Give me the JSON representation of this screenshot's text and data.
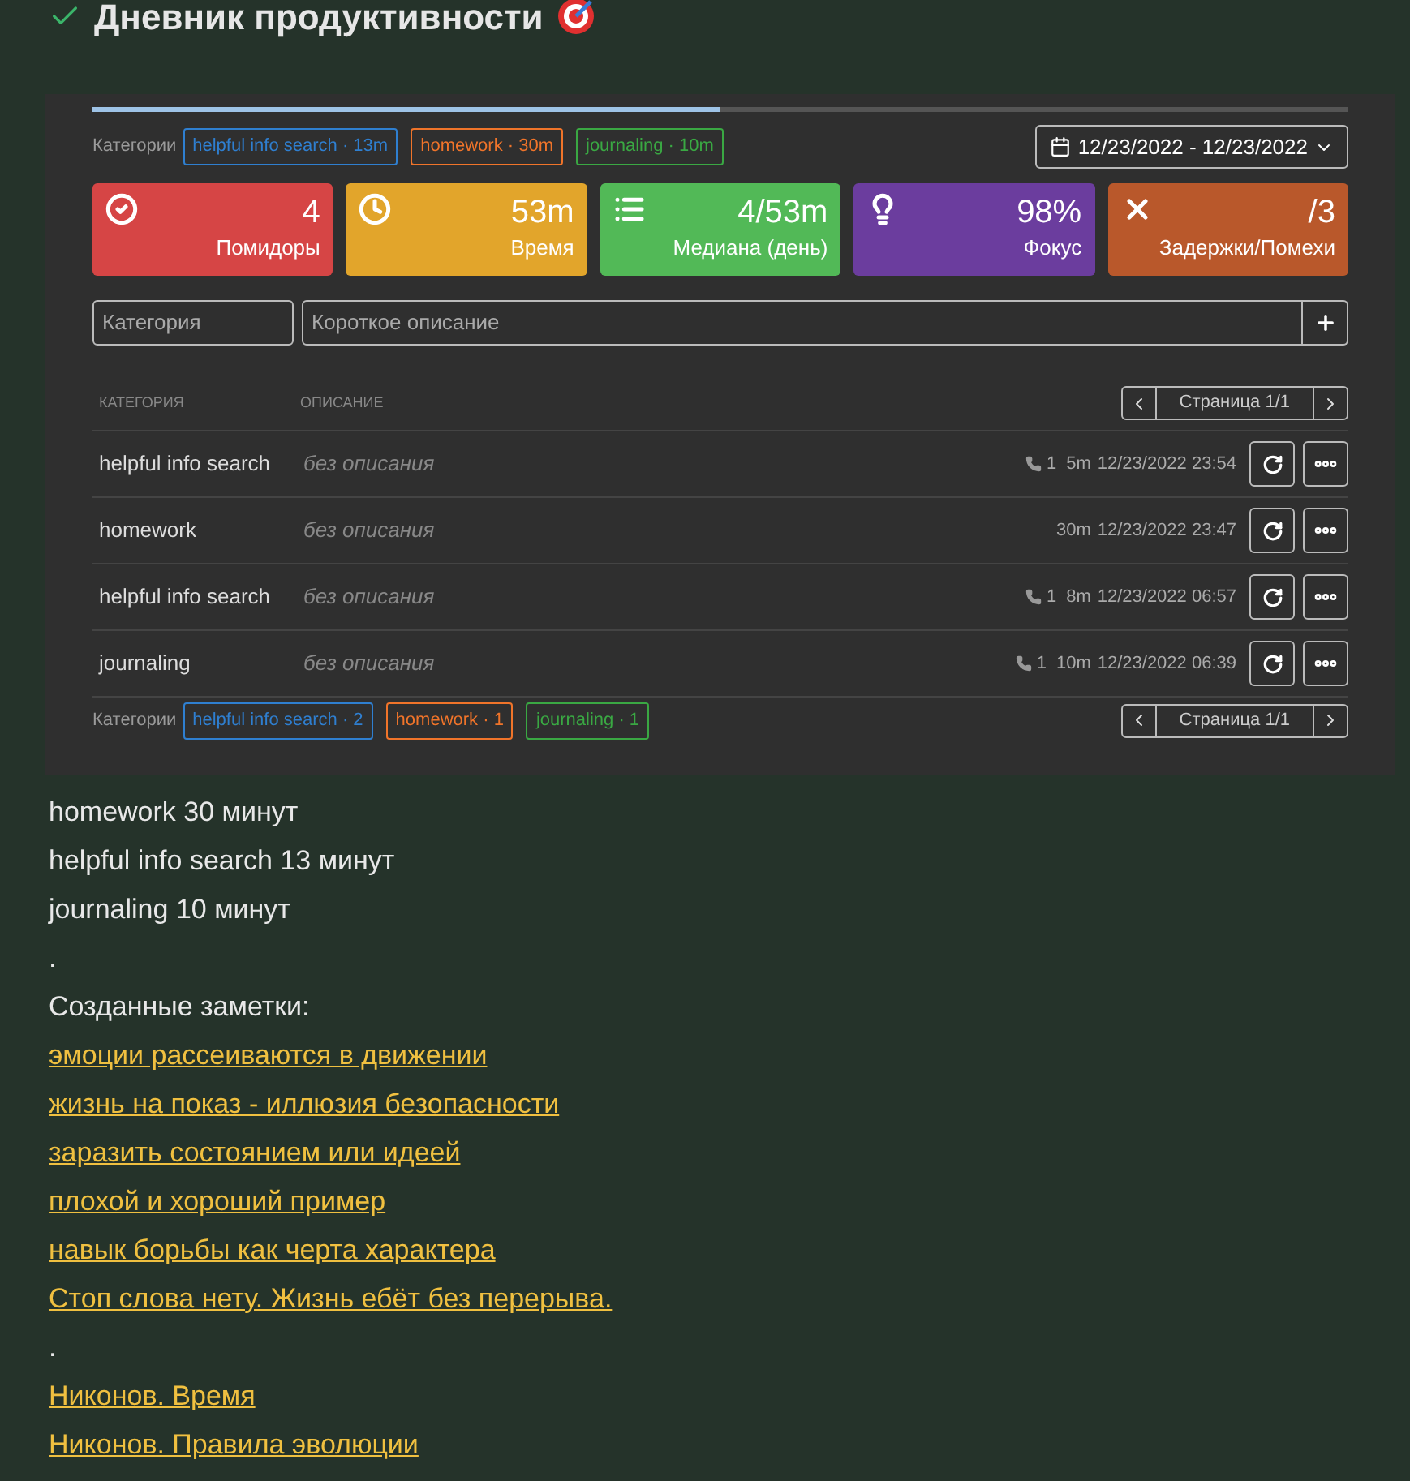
{
  "title": "Дневник продуктивности",
  "tabs": [
    {
      "selected": true
    },
    {
      "selected": false
    }
  ],
  "top_tags_label": "Категории",
  "top_tags": [
    {
      "label": "helpful info search · 13m",
      "color": "#2f7fd0"
    },
    {
      "label": "homework · 30m",
      "color": "#f0742a"
    },
    {
      "label": "journaling · 10m",
      "color": "#3aa843"
    }
  ],
  "date_range": "12/23/2022 - 12/23/2022",
  "stats": [
    {
      "kind": "check",
      "value": "4",
      "label": "Помидоры",
      "color": "#d64545"
    },
    {
      "kind": "clock",
      "value": "53m",
      "label": "Время",
      "color": "#e2a52b"
    },
    {
      "kind": "list",
      "value": "4/53m",
      "label": "Медиана (день)",
      "color": "#52b957"
    },
    {
      "kind": "bulb",
      "value": "98%",
      "label": "Фокус",
      "color": "#6b3d9e"
    },
    {
      "kind": "cross",
      "value": "/3",
      "label": "Задержки/Помехи",
      "color": "#b9582b"
    }
  ],
  "form": {
    "category_placeholder": "Категория",
    "description_placeholder": "Короткое описание"
  },
  "columns": [
    "КАТЕГОРИЯ",
    "ОПИСАНИЕ"
  ],
  "pager": "Страница 1/1",
  "rows": [
    {
      "category": "helpful info search",
      "description": "без описания",
      "calls": "1",
      "duration": "5m",
      "time": "12/23/2022 23:54"
    },
    {
      "category": "homework",
      "description": "без описания",
      "duration": "30m",
      "time": "12/23/2022 23:47"
    },
    {
      "category": "helpful info search",
      "description": "без описания",
      "calls": "1",
      "duration": "8m",
      "time": "12/23/2022 06:57"
    },
    {
      "category": "journaling",
      "description": "без описания",
      "calls": "1",
      "duration": "10m",
      "time": "12/23/2022 06:39"
    }
  ],
  "bottom_tags_label": "Категории",
  "bottom_tags": [
    {
      "label": "helpful info search · 2",
      "color": "#2f7fd0"
    },
    {
      "label": "homework · 1",
      "color": "#f0742a"
    },
    {
      "label": "journaling · 1",
      "color": "#3aa843"
    }
  ],
  "bottom_pager": "Страница 1/1",
  "summary": [
    "homework 30 минут",
    "helpful info search 13 минут",
    "journaling 10 минут",
    "."
  ],
  "notes_heading": "Созданные заметки:",
  "notes": [
    {
      "kind": "link",
      "text": "эмоции рассеиваются в движении"
    },
    {
      "kind": "link",
      "text": "жизнь на показ - иллюзия безопасности"
    },
    {
      "kind": "link",
      "text": "заразить состоянием или идеей"
    },
    {
      "kind": "link",
      "text": "плохой и хороший пример"
    },
    {
      "kind": "link",
      "text": "навык борьбы как черта характера"
    },
    {
      "kind": "link",
      "text": "Стоп слова нету. Жизнь ебёт без перерыва."
    },
    {
      "kind": "text",
      "text": "."
    },
    {
      "kind": "link",
      "text": "Никонов. Время"
    },
    {
      "kind": "link",
      "text": "Никонов. Правила эволюции"
    }
  ]
}
